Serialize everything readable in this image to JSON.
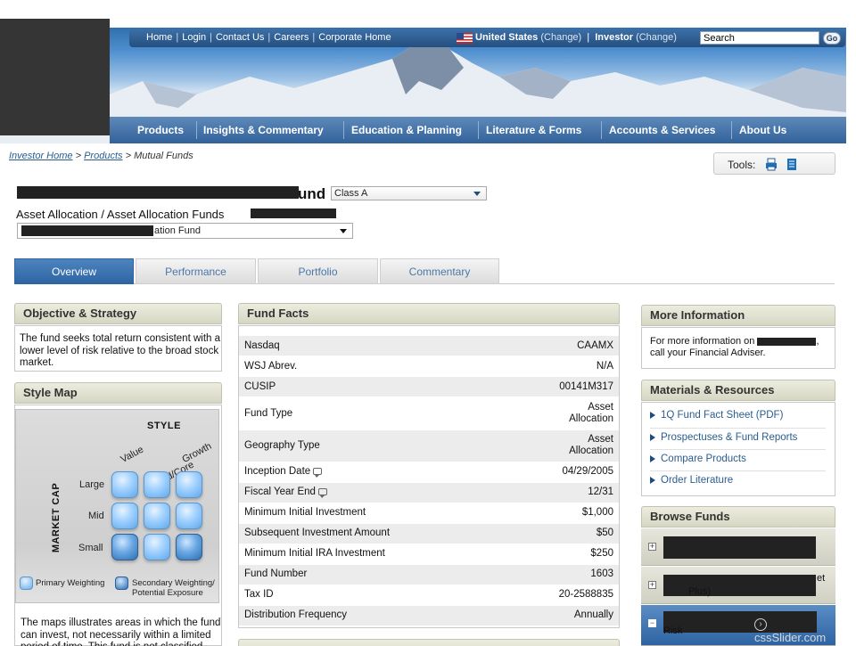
{
  "header": {
    "top_links": [
      "Home",
      "Login",
      "Contact Us",
      "Careers",
      "Corporate Home"
    ],
    "region_country": "United States",
    "region_change": "(Change)",
    "region_role": "Investor",
    "region_role_change": "(Change)",
    "search_placeholder": "Search",
    "go_label": "Go"
  },
  "main_nav": [
    "Products",
    "Insights & Commentary",
    "Education & Planning",
    "Literature & Forms",
    "Accounts & Services",
    "About Us"
  ],
  "breadcrumb": {
    "items": [
      "Investor Home",
      "Products"
    ],
    "separator": ">",
    "current": "Mutual Funds"
  },
  "tools": {
    "label": "Tools:",
    "icons": [
      "print-icon",
      "document-icon"
    ]
  },
  "fund": {
    "title_tail": "und",
    "class_value": "Class A",
    "category": "Asset Allocation / Asset Allocation Funds",
    "fund_select_tail": "ation Fund"
  },
  "tabs": [
    "Overview",
    "Performance",
    "Portfolio",
    "Commentary"
  ],
  "active_tab": "Overview",
  "objective": {
    "heading": "Objective & Strategy",
    "text": "The fund seeks total return consistent with a lower level of risk relative to the broad stock market."
  },
  "style_map": {
    "heading": "Style Map",
    "style_label": "STYLE",
    "columns": [
      "Value",
      "Blend/Core",
      "Growth"
    ],
    "market_cap_label": "MARKET CAP",
    "rows": [
      "Large",
      "Mid",
      "Small"
    ],
    "secondary_cells": [
      "Small-Value",
      "Small-Growth"
    ],
    "legend_primary": "Primary Weighting",
    "legend_secondary_line1": "Secondary Weighting/",
    "legend_secondary_line2": "Potential Exposure",
    "note": "The maps illustrates areas in which the fund can invest, not necessarily within a limited period of time. This fund is not classified"
  },
  "fund_facts": {
    "heading": "Fund Facts",
    "rows": [
      {
        "label": "Nasdaq",
        "value": "CAAMX"
      },
      {
        "label": "WSJ Abrev.",
        "value": "N/A"
      },
      {
        "label": "CUSIP",
        "value": "00141M317"
      },
      {
        "label": "Fund Type",
        "value_line1": "Asset",
        "value_line2": "Allocation"
      },
      {
        "label": "Geography Type",
        "value_line1": "Asset",
        "value_line2": "Allocation"
      },
      {
        "label": "Inception Date",
        "value": "04/29/2005"
      },
      {
        "label": "Fiscal Year End",
        "value": "12/31"
      },
      {
        "label": "Minimum Initial Investment",
        "value": "$1,000"
      },
      {
        "label": "Subsequent Investment Amount",
        "value": "$50"
      },
      {
        "label": "Minimum Initial IRA Investment",
        "value": "$250"
      },
      {
        "label": "Fund Number",
        "value": "1603"
      },
      {
        "label": "Tax ID",
        "value": "20-2588835"
      },
      {
        "label": "Distribution Frequency",
        "value": "Annually"
      }
    ]
  },
  "more_info": {
    "heading": "More Information",
    "text_line1": "For more information on",
    "text_line1_tail": ",",
    "text_line2": "call your Financial Adviser."
  },
  "materials": {
    "heading": "Materials & Resources",
    "links": [
      "1Q Fund Fact Sheet (PDF)",
      "Prospectuses & Fund Reports",
      "Compare Products",
      "Order Literature"
    ]
  },
  "browse": {
    "heading": "Browse Funds",
    "visible_fragments": [
      "et",
      "Plus)",
      "Risk"
    ]
  },
  "watermark": "cssSlider.com"
}
